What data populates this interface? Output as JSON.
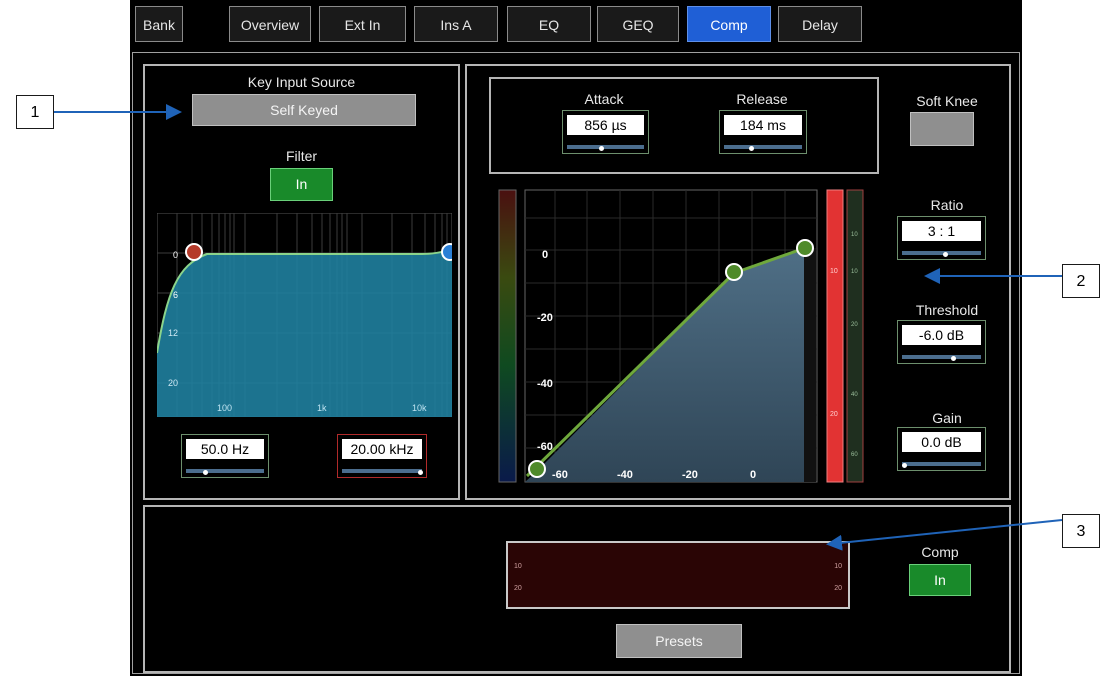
{
  "tabs": [
    "Bank",
    "Overview",
    "Ext In",
    "Ins A",
    "EQ",
    "GEQ",
    "Comp",
    "Delay"
  ],
  "active_tab": "Comp",
  "key_input": {
    "label": "Key Input Source",
    "value": "Self Keyed"
  },
  "filter": {
    "label": "Filter",
    "button": "In",
    "graph_y_labels": [
      "0",
      "6",
      "12",
      "20"
    ],
    "graph_x_labels": [
      "100",
      "1k",
      "10k"
    ],
    "hpf": {
      "value": "50.0 Hz",
      "level": 0.25
    },
    "lpf": {
      "value": "20.00 kHz",
      "level": 0.98
    }
  },
  "attack": {
    "label": "Attack",
    "value": "856 µs",
    "level": 0.45
  },
  "release": {
    "label": "Release",
    "value": "184 ms",
    "level": 0.35
  },
  "soft_knee": {
    "label": "Soft Knee"
  },
  "ratio": {
    "label": "Ratio",
    "value": "3 : 1",
    "level": 0.55
  },
  "threshold": {
    "label": "Threshold",
    "value": "-6.0 dB",
    "level": 0.65
  },
  "gain": {
    "label": "Gain",
    "value": "0.0 dB",
    "level": 0.03
  },
  "comp_graph": {
    "y_labels": [
      "0",
      "-20",
      "-40",
      "-60"
    ],
    "x_labels": [
      "-60",
      "-40",
      "-20",
      "0"
    ],
    "meter_labels": [
      "10",
      "20"
    ],
    "right_meter_labels": [
      "10",
      "10",
      "20",
      "40",
      "60"
    ]
  },
  "gr_meter": {
    "labels_left": [
      "10",
      "20"
    ],
    "labels_right": [
      "10",
      "20"
    ]
  },
  "comp_enable": {
    "label": "Comp",
    "button": "In"
  },
  "presets": {
    "label": "Presets"
  },
  "callouts": [
    "1",
    "2",
    "3"
  ]
}
